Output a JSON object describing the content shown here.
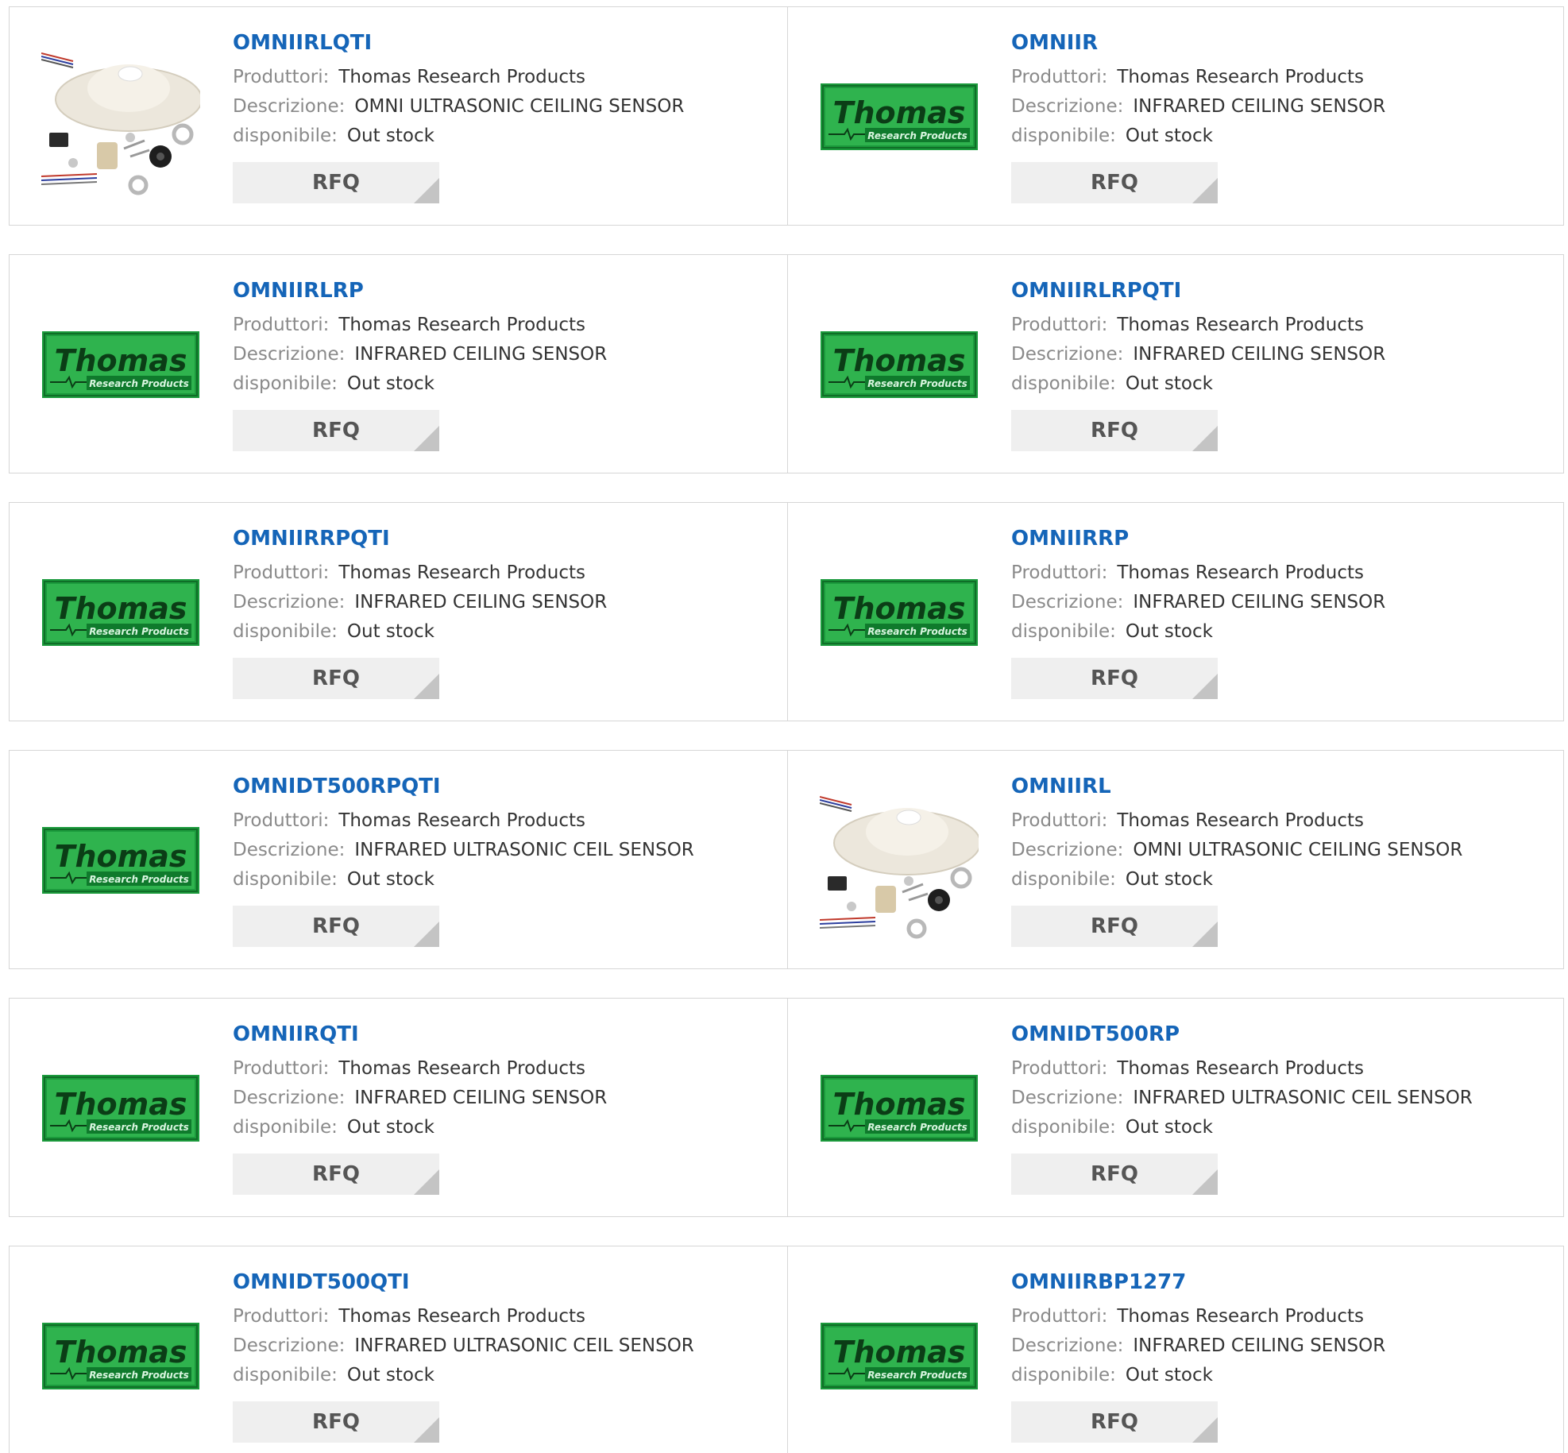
{
  "labels": {
    "manufacturer": "Produttori:",
    "description": "Descrizione:",
    "availability": "disponibile:",
    "rfq": "RFQ"
  },
  "logo": {
    "brand_word": "Thomas",
    "brand_sub": "Research Products"
  },
  "colors": {
    "part_link": "#1565b8",
    "logo_green": "#1b9a3c",
    "border": "#d6d6d6",
    "rfq_bg": "#efefef"
  },
  "products": [
    {
      "part": "OMNIIRLQTI",
      "manufacturer": "Thomas Research Products",
      "description": "OMNI ULTRASONIC CEILING SENSOR",
      "availability": "Out stock",
      "image": "sensor-photo"
    },
    {
      "part": "OMNIIR",
      "manufacturer": "Thomas Research Products",
      "description": "INFRARED CEILING SENSOR",
      "availability": "Out stock",
      "image": "brand-logo"
    },
    {
      "part": "OMNIIRLRP",
      "manufacturer": "Thomas Research Products",
      "description": "INFRARED CEILING SENSOR",
      "availability": "Out stock",
      "image": "brand-logo"
    },
    {
      "part": "OMNIIRLRPQTI",
      "manufacturer": "Thomas Research Products",
      "description": "INFRARED CEILING SENSOR",
      "availability": "Out stock",
      "image": "brand-logo"
    },
    {
      "part": "OMNIIRRPQTI",
      "manufacturer": "Thomas Research Products",
      "description": "INFRARED CEILING SENSOR",
      "availability": "Out stock",
      "image": "brand-logo"
    },
    {
      "part": "OMNIIRRP",
      "manufacturer": "Thomas Research Products",
      "description": "INFRARED CEILING SENSOR",
      "availability": "Out stock",
      "image": "brand-logo"
    },
    {
      "part": "OMNIDT500RPQTI",
      "manufacturer": "Thomas Research Products",
      "description": "INFRARED ULTRASONIC CEIL SENSOR",
      "availability": "Out stock",
      "image": "brand-logo"
    },
    {
      "part": "OMNIIRL",
      "manufacturer": "Thomas Research Products",
      "description": "OMNI ULTRASONIC CEILING SENSOR",
      "availability": "Out stock",
      "image": "sensor-photo"
    },
    {
      "part": "OMNIIRQTI",
      "manufacturer": "Thomas Research Products",
      "description": "INFRARED CEILING SENSOR",
      "availability": "Out stock",
      "image": "brand-logo"
    },
    {
      "part": "OMNIDT500RP",
      "manufacturer": "Thomas Research Products",
      "description": "INFRARED ULTRASONIC CEIL SENSOR",
      "availability": "Out stock",
      "image": "brand-logo"
    },
    {
      "part": "OMNIDT500QTI",
      "manufacturer": "Thomas Research Products",
      "description": "INFRARED ULTRASONIC CEIL SENSOR",
      "availability": "Out stock",
      "image": "brand-logo"
    },
    {
      "part": "OMNIIRBP1277",
      "manufacturer": "Thomas Research Products",
      "description": "INFRARED CEILING SENSOR",
      "availability": "Out stock",
      "image": "brand-logo"
    }
  ]
}
